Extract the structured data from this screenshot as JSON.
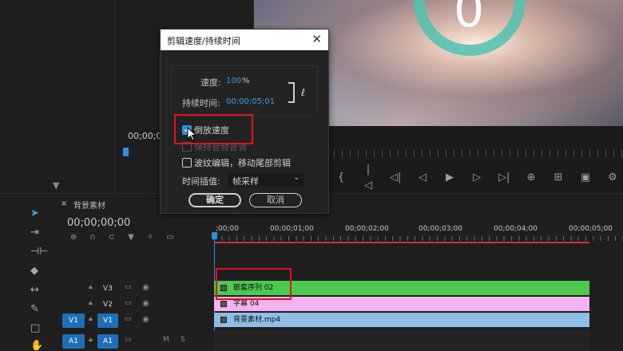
{
  "source_monitor": {
    "timecode": "00;00;0",
    "filter_label": "▼"
  },
  "program_monitor": {
    "digit": "0",
    "controls": [
      "{",
      "|◁",
      "◁|",
      "◁",
      "▶",
      "▷",
      "▷|",
      "⊕",
      "⊞",
      "▣",
      "⚙"
    ]
  },
  "dialog": {
    "title": "剪辑速度/持续时间",
    "close_label": "✕",
    "speed_label": "速度:",
    "speed_value": "100",
    "speed_unit": "%",
    "duration_label": "持续时间:",
    "duration_value": "00;00;05;01",
    "link_icon": "ℓ",
    "reverse_label": "倒放速度",
    "reverse_checked": true,
    "maintain_pitch_label": "保持音频音调",
    "ripple_label": "波纹编辑，移动尾部剪辑",
    "interp_label": "时间插值:",
    "interp_value": "帧采样",
    "ok_label": "确定",
    "cancel_label": "取消"
  },
  "timeline": {
    "tab_close": "×",
    "tab_label": "背景素材",
    "timecode": "00;00;00;00",
    "ruler": [
      ";00;00",
      "00;00;01;00",
      "00;00;02;00",
      "00;00;03;00",
      "00;00;04;00",
      "00;00;05;00"
    ],
    "tracks": [
      {
        "target": "",
        "name": "V3"
      },
      {
        "target": "",
        "name": "V2"
      },
      {
        "target": "V1",
        "name": "V1"
      },
      {
        "target": "A1",
        "name": "A1"
      }
    ],
    "clips": {
      "nested": "嵌套序列 02",
      "title": "字幕 04",
      "video": "背景素材.mp4"
    }
  },
  "colors": {
    "accent": "#2f8fe0",
    "nested_clip": "#4cc94f",
    "title_clip": "#f2b3ef",
    "video_clip": "#8ebde6",
    "highlight": "#e1141b"
  }
}
